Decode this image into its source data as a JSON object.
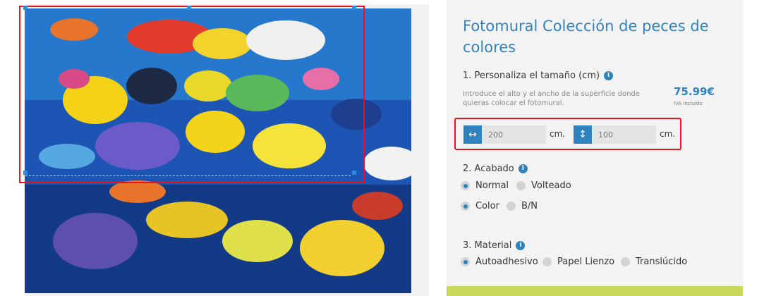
{
  "product": {
    "title": "Fotomural Colección de peces de colores"
  },
  "size_section": {
    "heading": "1. Personaliza el tamaño (cm)",
    "info_icon": "i",
    "description": "Introduce el alto y el ancho de la superficie donde quieras colocar el fotomural.",
    "price": "75.99€",
    "price_note": "IVA incluido",
    "width_value": "200",
    "height_value": "100",
    "unit": "cm.",
    "width_icon": "horizontal-arrows-icon",
    "height_icon": "vertical-arrows-icon"
  },
  "finish_section": {
    "heading": "2. Acabado",
    "info_icon": "i",
    "option_normal": "Normal",
    "option_flipped": "Volteado",
    "option_color": "Color",
    "option_bw": "B/N"
  },
  "material_section": {
    "heading": "3. Material",
    "info_icon": "i",
    "option_adhesive": "Autoadhesivo",
    "option_canvas": "Papel Lienzo",
    "option_translucent": "Translúcido"
  },
  "colors": {
    "accent": "#2f84c0",
    "crop_border": "#e5141d",
    "footer_band": "#c8d85c"
  }
}
